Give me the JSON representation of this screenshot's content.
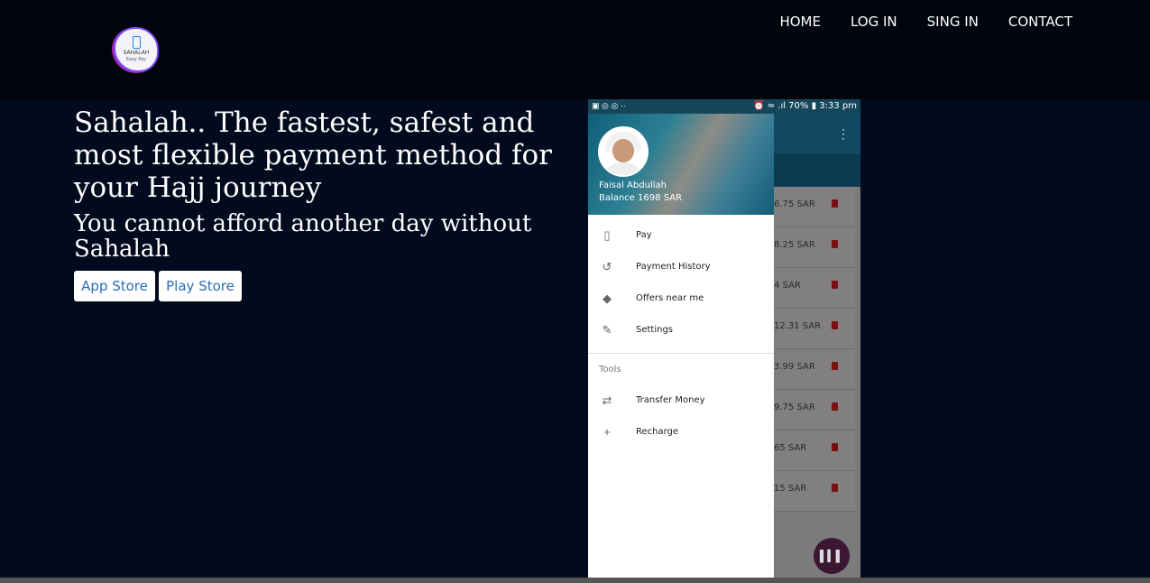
{
  "logo": {
    "line1": "SAHALAH",
    "line2": "Easy Pay"
  },
  "nav": {
    "home": "HOME",
    "login": "LOG IN",
    "signin": "SING IN",
    "contact": "CONTACT"
  },
  "hero": {
    "headline": "Sahalah.. The fastest, safest and most flexible payment method for your Hajj journey",
    "subline": "You cannot afford another day without Sahalah",
    "app_store": "App Store",
    "play_store": "Play Store"
  },
  "phone": {
    "status": {
      "left": "▣ ◎ ◎ ··",
      "right": "⏰ ≈ .ıl 70% ▮ 3:33 pm"
    },
    "user": {
      "name": "Faisal Abdullah",
      "balance": "Balance 1698 SAR"
    },
    "menu": [
      {
        "label": "Pay",
        "icon": "phone-icon"
      },
      {
        "label": "Payment History",
        "icon": "history-icon"
      },
      {
        "label": "Offers near me",
        "icon": "tag-icon"
      },
      {
        "label": "Settings",
        "icon": "wrench-icon"
      }
    ],
    "tools_title": "Tools",
    "tools": [
      {
        "label": "Transfer Money",
        "icon": "transfer-icon"
      },
      {
        "label": "Recharge",
        "icon": "plus-icon"
      }
    ],
    "amounts": [
      "6.75 SAR",
      "8.25 SAR",
      "4 SAR",
      "12.31 SAR",
      "3.99 SAR",
      "9.75  SAR",
      "65 SAR",
      "15 SAR"
    ],
    "fab": "barcode-icon"
  }
}
